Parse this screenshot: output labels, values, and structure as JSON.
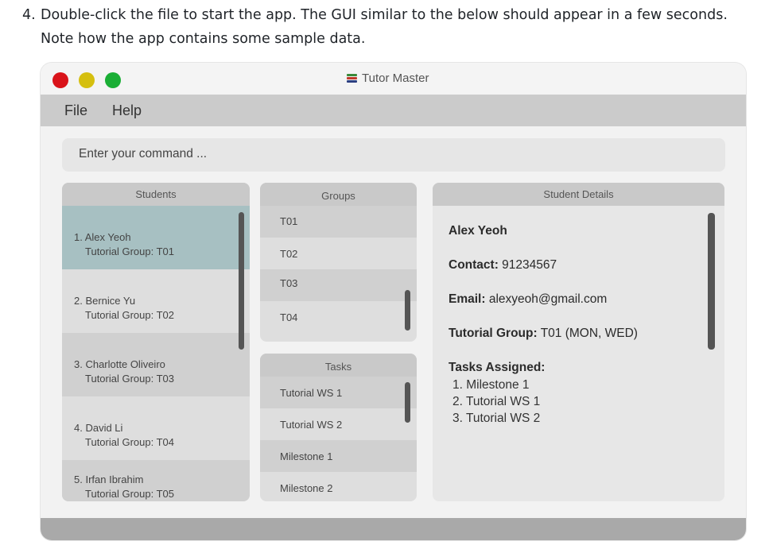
{
  "instruction": {
    "number": "4.",
    "text": "Double-click the file to start the app. The GUI similar to the below should appear in a few seconds. Note how the app contains some sample data."
  },
  "window": {
    "title": "Tutor Master",
    "app_icon": "books-icon"
  },
  "menu": {
    "file": "File",
    "help": "Help"
  },
  "command": {
    "placeholder": "Enter your command ..."
  },
  "students": {
    "header": "Students",
    "items": [
      {
        "name": "1. Alex Yeoh",
        "group": "Tutorial Group: T01",
        "selected": true
      },
      {
        "name": "2. Bernice Yu",
        "group": "Tutorial Group: T02"
      },
      {
        "name": "3. Charlotte Oliveiro",
        "group": "Tutorial Group: T03"
      },
      {
        "name": "4. David Li",
        "group": "Tutorial Group: T04"
      },
      {
        "name": "5. Irfan Ibrahim",
        "group": "Tutorial Group: T05"
      }
    ]
  },
  "groups": {
    "header": "Groups",
    "items": [
      "T01",
      "T02",
      "T03",
      "T04"
    ]
  },
  "tasks": {
    "header": "Tasks",
    "items": [
      "Tutorial WS 1",
      "Tutorial WS 2",
      "Milestone 1",
      "Milestone 2"
    ]
  },
  "details": {
    "header": "Student Details",
    "name": "Alex Yeoh",
    "contact_label": "Contact:",
    "contact_value": "91234567",
    "email_label": "Email:",
    "email_value": "alexyeoh@gmail.com",
    "group_label": "Tutorial Group:",
    "group_value": "T01 (MON, WED)",
    "tasks_label": "Tasks Assigned:",
    "tasks": [
      "1. Milestone 1",
      "2. Tutorial WS 1",
      "3. Tutorial WS 2"
    ]
  },
  "colors": {
    "close": "#d9131a",
    "minimize": "#d5bf0f",
    "maximize": "#1aae35",
    "selected_row": "#a7c0c2"
  }
}
